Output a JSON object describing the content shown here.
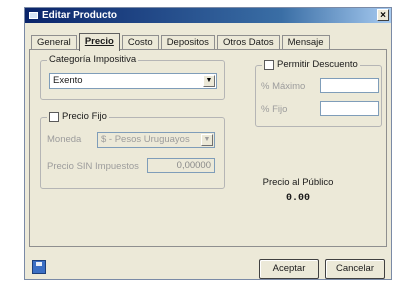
{
  "window": {
    "title": "Editar Producto",
    "close_label": "×"
  },
  "tabs": [
    {
      "label": "General",
      "active": false
    },
    {
      "label": "Precio",
      "active": true
    },
    {
      "label": "Costo",
      "active": false
    },
    {
      "label": "Depositos",
      "active": false
    },
    {
      "label": "Otros Datos",
      "active": false
    },
    {
      "label": "Mensaje",
      "active": false
    }
  ],
  "categoria": {
    "legend": "Categoría Impositiva",
    "value": "Exento"
  },
  "precio_fijo": {
    "legend": "Precio Fijo",
    "moneda_label": "Moneda",
    "moneda_value": "$ - Pesos Uruguayos",
    "sin_impuestos_label": "Precio SIN Impuestos",
    "sin_impuestos_value": "0,00000"
  },
  "descuento": {
    "legend": "Permitir Descuento",
    "maximo_label": "% Máximo",
    "maximo_value": "",
    "fijo_label": "% Fijo",
    "fijo_value": ""
  },
  "precio_publico": {
    "label": "Precio al Público",
    "value": "0.00"
  },
  "buttons": {
    "aceptar": "Aceptar",
    "cancelar": "Cancelar"
  },
  "colors": {
    "titlebar": "#0a246a",
    "dialog_bg": "#ece9d8",
    "save_icon": "#3b6fc4"
  },
  "dropdown_arrow": "▼"
}
